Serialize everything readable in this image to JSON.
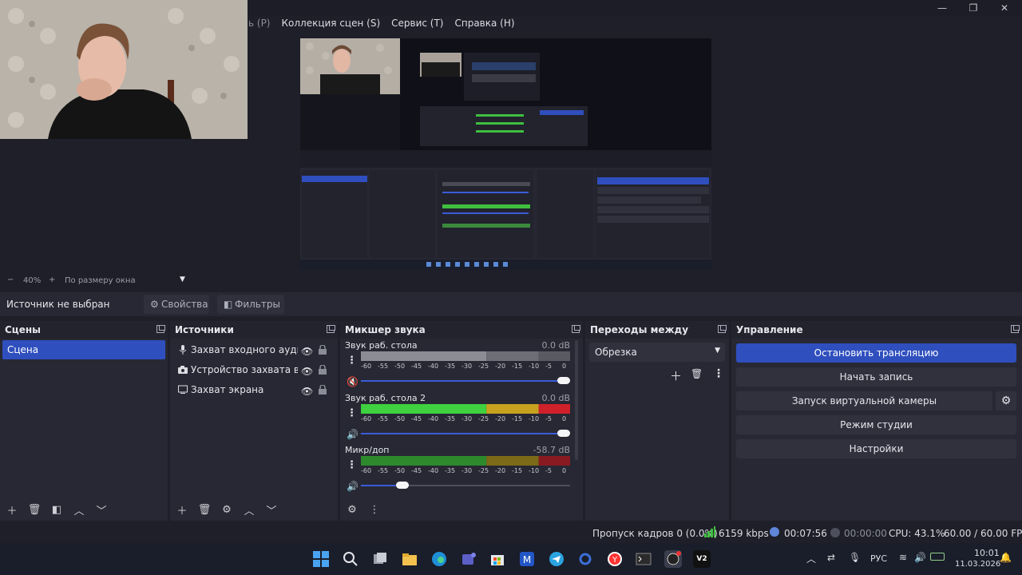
{
  "menu": {
    "partial": "ь (P)",
    "items": [
      "Коллекция сцен (S)",
      "Сервис (T)",
      "Справка (H)"
    ]
  },
  "zoom": {
    "minus": "−",
    "level": "40%",
    "plus": "+",
    "fit": "По размеру окна"
  },
  "source_toolbar": {
    "status": "Источник не выбран",
    "properties": "Свойства",
    "filters": "Фильтры"
  },
  "scenes": {
    "title": "Сцены",
    "items": [
      "Сцена"
    ]
  },
  "sources": {
    "title": "Источники",
    "items": [
      {
        "label": "Захват входного аудиопс",
        "icon": "microphone-icon"
      },
      {
        "label": "Устройство захвата виде",
        "icon": "camera-icon"
      },
      {
        "label": "Захват экрана",
        "icon": "monitor-icon"
      }
    ]
  },
  "mixer": {
    "title": "Микшер звука",
    "scale": [
      "-60",
      "-55",
      "-50",
      "-45",
      "-40",
      "-35",
      "-30",
      "-25",
      "-20",
      "-15",
      "-10",
      "-5",
      "0"
    ],
    "channels": [
      {
        "name": "Звук раб. стола",
        "db": "0.0 dB",
        "volume": 1.0,
        "muted": true
      },
      {
        "name": "Звук раб. стола 2",
        "db": "0.0 dB",
        "volume": 1.0,
        "muted": false
      },
      {
        "name": "Микр/доп",
        "db": "-58.7 dB",
        "volume": 0.18,
        "muted": false
      }
    ]
  },
  "transitions": {
    "title": "Переходы между сцена...",
    "selected": "Обрезка"
  },
  "controls": {
    "title": "Управление",
    "stop_stream": "Остановить трансляцию",
    "start_record": "Начать запись",
    "virtual_cam": "Запуск виртуальной камеры",
    "studio_mode": "Режим студии",
    "settings": "Настройки"
  },
  "status": {
    "dropped": "Пропуск кадров 0 (0.0%)",
    "bitrate": "6159 kbps",
    "stream_time": "00:07:56",
    "record_time": "00:00:00",
    "cpu": "CPU: 43.1%",
    "fps": "60.00 / 60.00 FPS"
  },
  "taskbar": {
    "lang": "РУС",
    "time": "10:01",
    "date": "11.03.2026",
    "obs_badge": "V2"
  },
  "colors": {
    "accent": "#2f4fbe",
    "bg": "#1e1f29",
    "panel": "#272833"
  }
}
